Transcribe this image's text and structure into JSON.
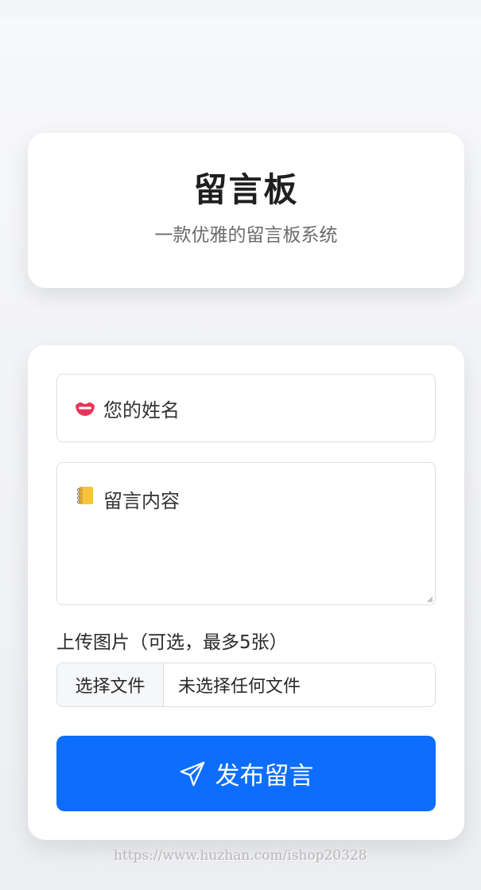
{
  "header": {
    "title": "留言板",
    "subtitle": "一款优雅的留言板系统"
  },
  "form": {
    "name_field": {
      "icon": "lips-emoji",
      "placeholder": "您的姓名"
    },
    "content_field": {
      "icon": "notebook-emoji",
      "placeholder": "留言内容"
    },
    "upload": {
      "label": "上传图片（可选，最多5张）",
      "button_label": "选择文件",
      "status": "未选择任何文件"
    },
    "submit": {
      "icon": "send-icon",
      "label": "发布留言"
    }
  },
  "watermark": "https://www.huzhan.com/ishop20328",
  "colors": {
    "accent": "#0d6efd",
    "card": "#ffffff",
    "background": "#f3f4f7"
  }
}
